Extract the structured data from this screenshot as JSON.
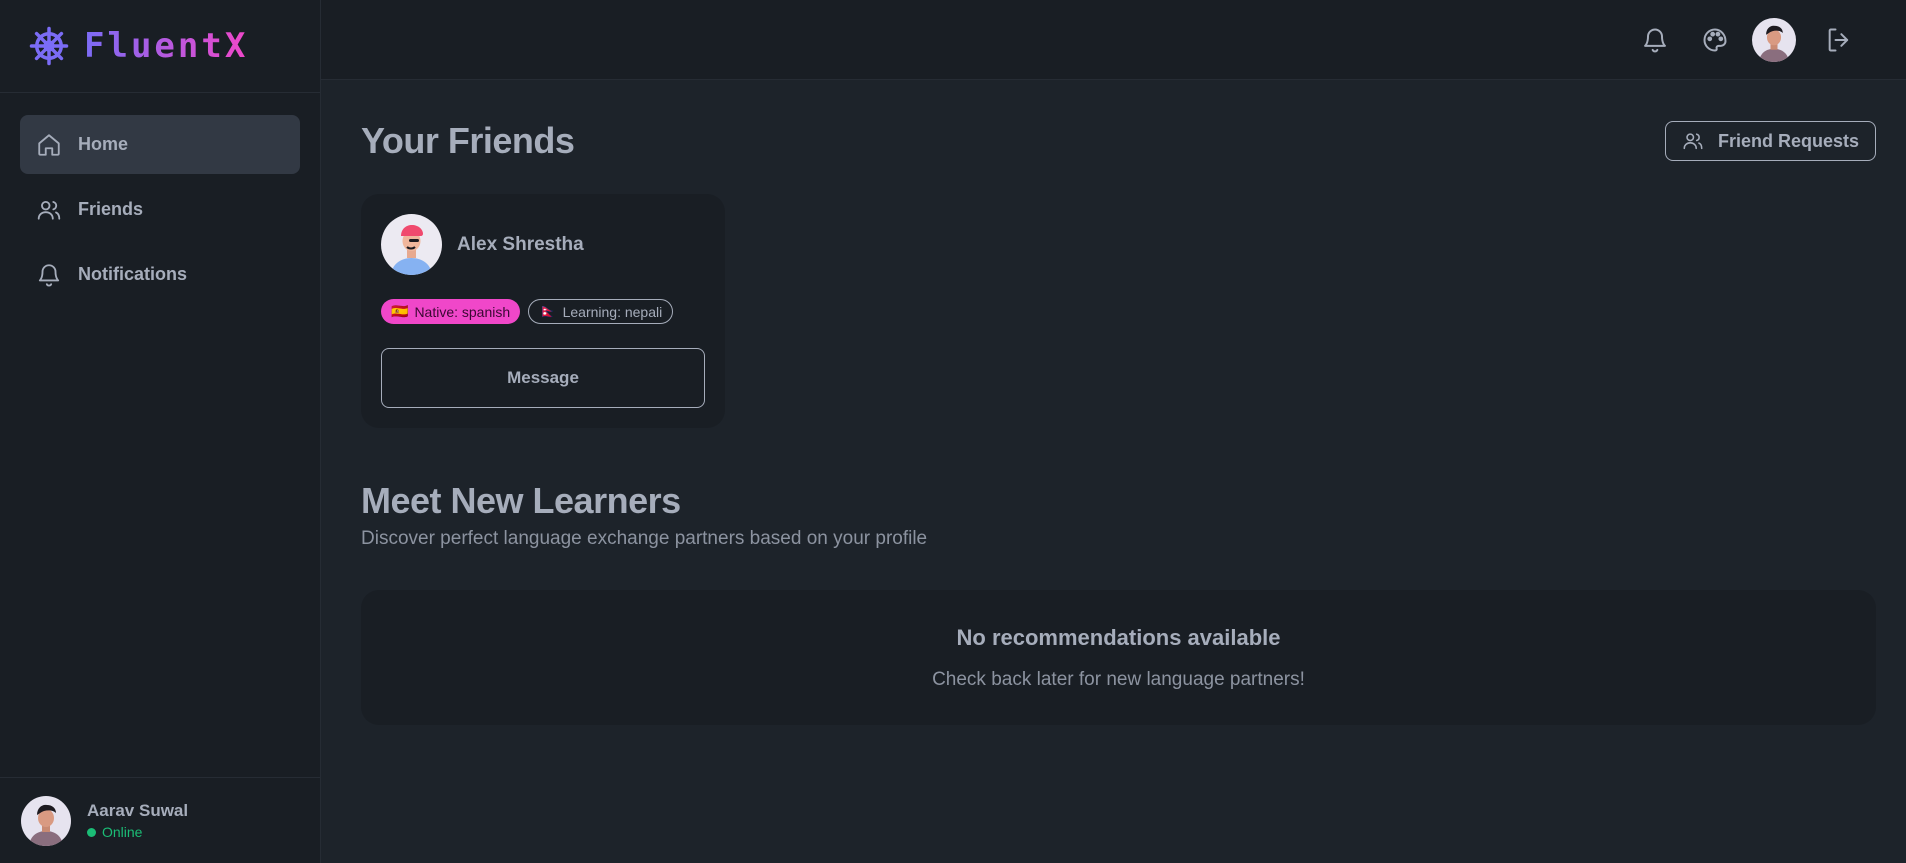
{
  "brand": {
    "name": "FluentX"
  },
  "sidebar": {
    "items": [
      {
        "label": "Home",
        "icon": "home-icon",
        "active": true
      },
      {
        "label": "Friends",
        "icon": "users-icon"
      },
      {
        "label": "Notifications",
        "icon": "bell-icon"
      }
    ],
    "user": {
      "name": "Aarav Suwal",
      "status": "Online"
    }
  },
  "header": {
    "icons": [
      "bell-icon",
      "palette-icon",
      "avatar",
      "logout-icon"
    ]
  },
  "friends_section": {
    "title": "Your Friends",
    "requests_button": "Friend Requests",
    "friends": [
      {
        "name": "Alex Shrestha",
        "native_flag": "🇪🇸",
        "native": "Native: spanish",
        "learning_flag": "🇳🇵",
        "learning": "Learning: nepali",
        "action": "Message"
      }
    ]
  },
  "learners_section": {
    "title": "Meet New Learners",
    "subtitle": "Discover perfect language exchange partners based on your profile",
    "empty_title": "No recommendations available",
    "empty_text": "Check back later for new language partners!"
  },
  "colors": {
    "accent_primary": "#7b6cf6",
    "accent_secondary": "#f047c9",
    "online": "#1bbd76"
  }
}
